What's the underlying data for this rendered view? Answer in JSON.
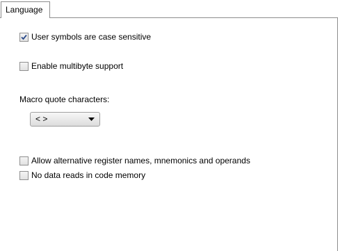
{
  "tabs": [
    {
      "label": "Language",
      "active": true
    }
  ],
  "options": {
    "case_sensitive": {
      "label": "User symbols are case sensitive",
      "checked": true
    },
    "multibyte": {
      "label": "Enable multibyte support",
      "checked": false
    },
    "alt_register_names": {
      "label": "Allow alternative register names, mnemonics and operands",
      "checked": false
    },
    "no_data_reads": {
      "label": "No data reads in code memory",
      "checked": false
    }
  },
  "macro_quote": {
    "label": "Macro quote characters:",
    "selected": "< >"
  },
  "colors": {
    "check_mark": "#2b4a8a",
    "border": "#8c8c8c"
  }
}
